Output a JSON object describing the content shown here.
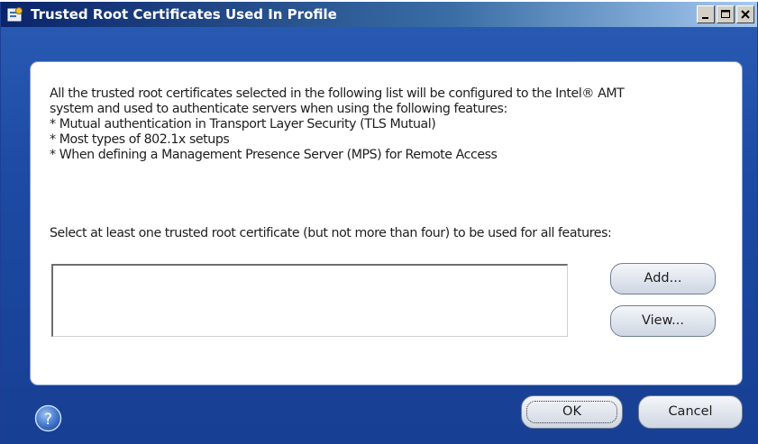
{
  "window": {
    "title": "Trusted Root Certificates Used In Profile",
    "icon": "settings-window-icon",
    "controls": {
      "minimize_icon": "minimize-icon",
      "maximize_icon": "maximize-icon",
      "close_icon": "close-icon"
    }
  },
  "panel": {
    "description_lines": [
      "All the trusted root certificates selected in the following list will be configured to the Intel® AMT",
      "system and used to authenticate servers when using the following features:",
      "* Mutual authentication in Transport Layer Security (TLS Mutual)",
      "* Most types of 802.1x setups",
      "* When defining a Management Presence Server (MPS) for Remote Access"
    ],
    "select_prompt": "Select at least one trusted root certificate (but not more than four) to be used for all features:",
    "certificates": [],
    "add_label": "Add...",
    "view_label": "View..."
  },
  "footer": {
    "help_icon": "help-icon",
    "ok_label": "OK",
    "cancel_label": "Cancel"
  },
  "colors": {
    "dialog_background": "#1d4aa3",
    "titlebar_start": "#0a246a",
    "titlebar_end": "#a6caf0",
    "panel_background": "#ffffff"
  }
}
